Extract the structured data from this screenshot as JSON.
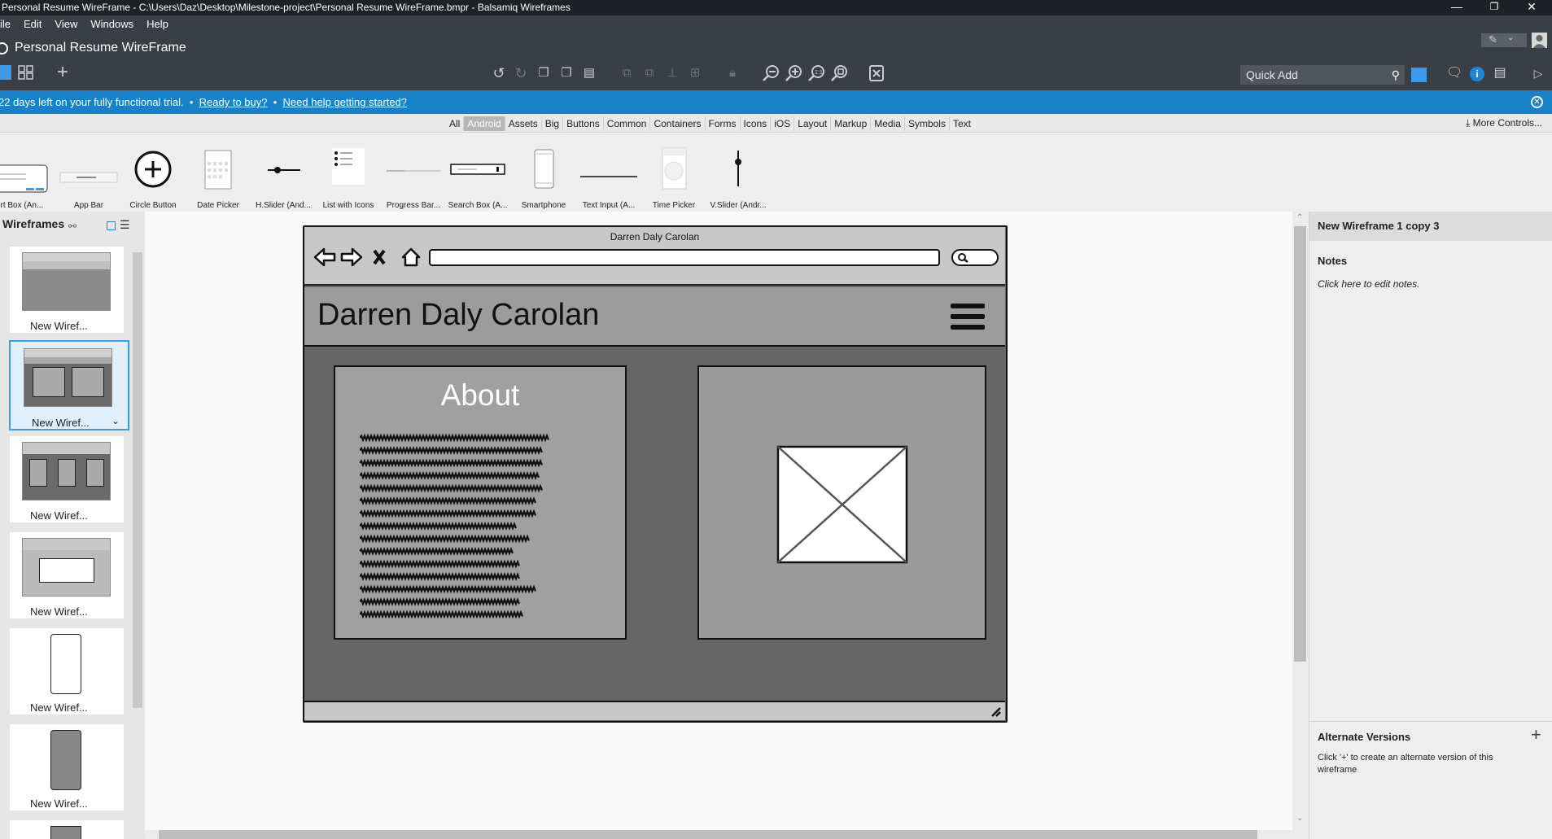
{
  "window": {
    "title": "Personal Resume WireFrame - C:\\Users\\Daz\\Desktop\\Milestone-project\\Personal Resume WireFrame.bmpr - Balsamiq Wireframes",
    "minimize": "—",
    "maximize": "❐",
    "close": "✕"
  },
  "menu": [
    "ile",
    "Edit",
    "View",
    "Windows",
    "Help"
  ],
  "project_title": "Personal Resume WireFrame",
  "quick_add": {
    "label": "Quick Add",
    "icon": "search-icon"
  },
  "trial": {
    "message": "22 days left on your fully functional trial.",
    "buy": "Ready to buy?",
    "help": "Need help getting started?",
    "bullet": "•"
  },
  "categories": {
    "items": [
      "All",
      "Android",
      "Assets",
      "Big",
      "Buttons",
      "Common",
      "Containers",
      "Forms",
      "Icons",
      "iOS",
      "Layout",
      "Markup",
      "Media",
      "Symbols",
      "Text"
    ],
    "selected": "Android",
    "more": "More Controls..."
  },
  "library": [
    "lert Box (An...",
    "App Bar",
    "Circle Button",
    "Date Picker",
    "H.Slider (And...",
    "List with Icons",
    "Progress Bar...",
    "Search Box (A...",
    "Smartphone",
    "Text Input (A...",
    "Time Picker",
    "V.Slider (Andr..."
  ],
  "wireframes_panel": {
    "title": "Wireframes",
    "items": [
      "New Wiref...",
      "New Wiref...",
      "New Wiref...",
      "New Wiref...",
      "New Wiref...",
      "New Wiref..."
    ],
    "selected_index": 1
  },
  "wireframe": {
    "browser_title": "Darren Daly Carolan",
    "header_name": "Darren Daly Carolan",
    "about_title": "About"
  },
  "right_panel": {
    "title": "New Wireframe 1 copy 3",
    "notes_title": "Notes",
    "notes_hint": "Click here to edit notes.",
    "alt_title": "Alternate Versions",
    "alt_plus": "+",
    "alt_desc": "Click '+' to create an alternate version of this wireframe"
  },
  "colors": {
    "title_bar": "#1e2227",
    "app_bar": "#3a3f45",
    "trial_banner": "#1782c9",
    "selection": "#3d9be9"
  }
}
